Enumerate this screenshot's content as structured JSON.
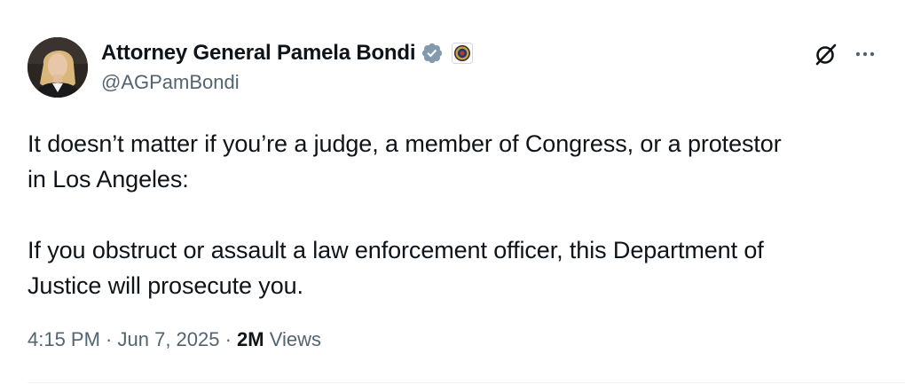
{
  "author": {
    "display_name": "Attorney General Pamela Bondi",
    "handle": "@AGPamBondi",
    "verified": true,
    "affiliation_icon": "doj-seal-icon",
    "avatar": "profile-photo"
  },
  "actions": {
    "grok_icon": "grok-icon",
    "more_icon": "more-horizontal-icon"
  },
  "post": {
    "paragraphs": [
      "It doesn’t matter if you’re a judge, a member of Congress, or a protestor\nin Los Angeles:",
      "If you obstruct or assault a law enforcement officer, this Department of\nJustice will prosecute you."
    ]
  },
  "meta": {
    "time": "4:15 PM",
    "separator": " · ",
    "date": "Jun 7, 2025",
    "views_count": "2M",
    "views_label": " Views"
  },
  "colors": {
    "text_primary": "#0f1419",
    "text_secondary": "#536471",
    "verified_blue": "#829aab",
    "divider": "#eff3f4"
  }
}
